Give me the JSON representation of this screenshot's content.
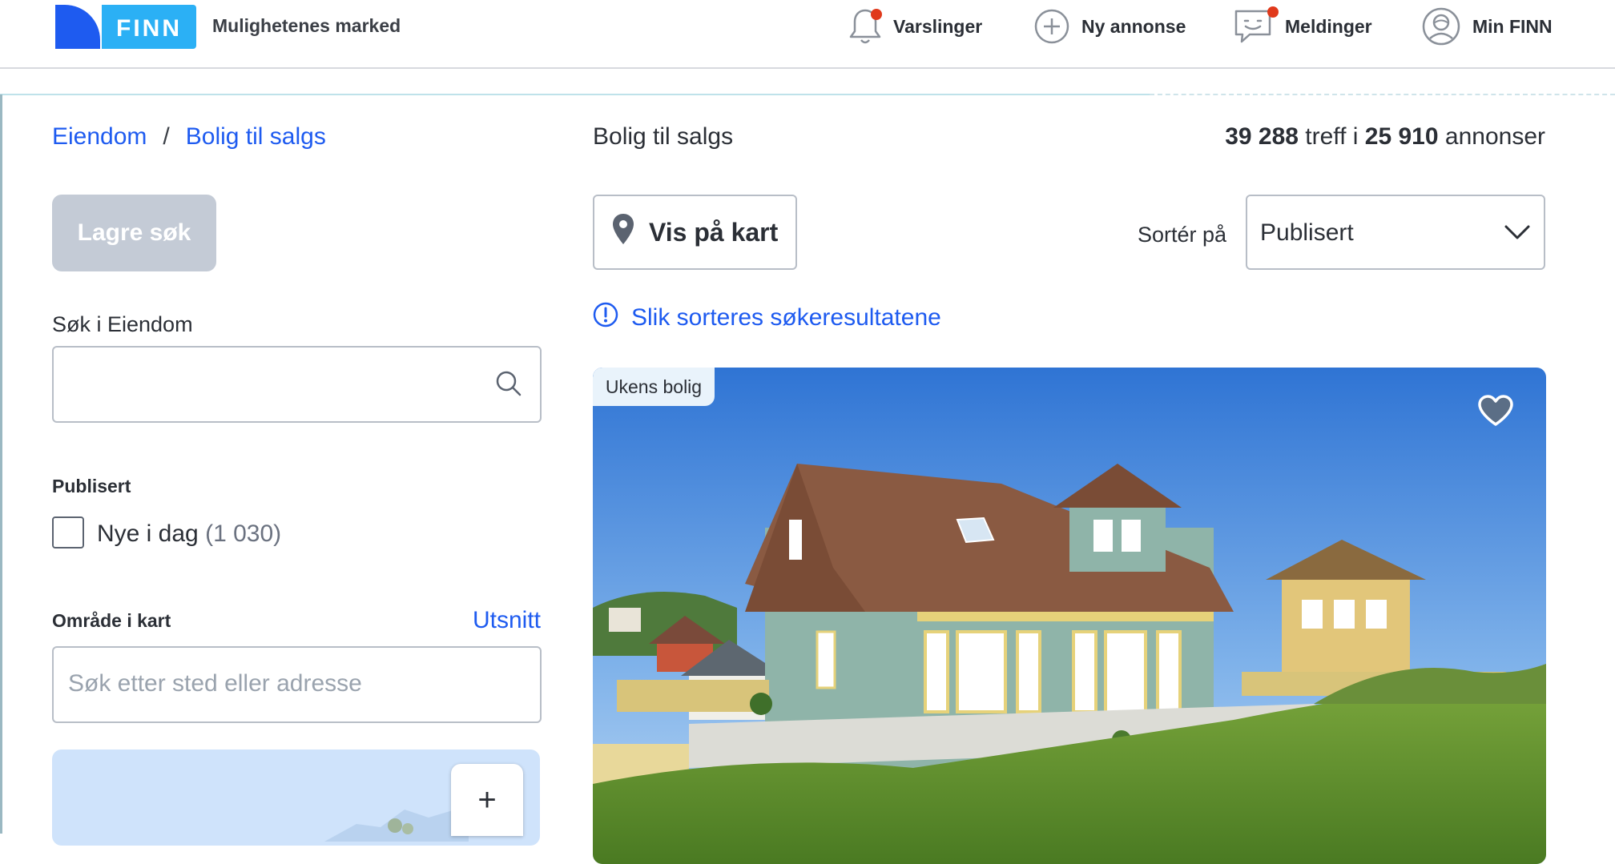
{
  "header": {
    "logo_text": "FINN",
    "slogan": "Mulighetenes marked",
    "nav": [
      {
        "label": "Varslinger",
        "icon": "bell-icon"
      },
      {
        "label": "Ny annonse",
        "icon": "plus-circle-icon"
      },
      {
        "label": "Meldinger",
        "icon": "chat-icon"
      },
      {
        "label": "Min FINN",
        "icon": "user-icon"
      }
    ]
  },
  "sidebar": {
    "breadcrumb": [
      "Eiendom",
      "Bolig til salgs"
    ],
    "breadcrumb_separator": "/",
    "save_search_label": "Lagre søk",
    "search_label": "Søk i Eiendom",
    "search_value": "",
    "published_label": "Publisert",
    "new_today_label": "Nye i dag",
    "new_today_count": "(1 030)",
    "area_label": "Område i kart",
    "area_link": "Utsnitt",
    "area_placeholder": "Søk etter sted eller adresse",
    "zoom_in_label": "+"
  },
  "main": {
    "title": "Bolig til salgs",
    "hits_count": "39 288",
    "hits_word": "treff i",
    "ads_count": "25 910",
    "ads_word": "annonser",
    "map_button_label": "Vis på kart",
    "sort_label": "Sortér på",
    "sort_value": "Publisert",
    "info_link": "Slik sorteres søkeresultatene"
  },
  "card": {
    "badge": "Ukens bolig"
  },
  "colors": {
    "brand_blue": "#1e5bf0",
    "logo_light_blue": "#2bb0f5",
    "notification_red": "#e0391b",
    "disabled_button": "#c4cbd6"
  }
}
